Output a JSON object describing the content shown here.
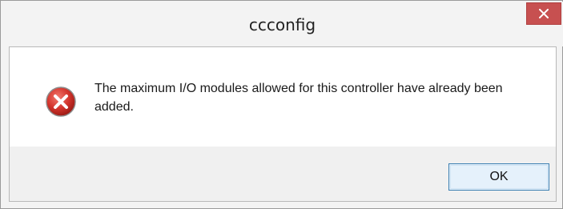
{
  "window": {
    "title": "ccconfig",
    "close_icon": "close-icon"
  },
  "message": {
    "icon": "error-icon",
    "text": "The maximum I/O modules allowed for this controller have already been added."
  },
  "buttons": {
    "ok_label": "OK"
  },
  "colors": {
    "close_button": "#c75050",
    "error_icon": "#d3342c",
    "ok_border": "#3c7fb1"
  }
}
